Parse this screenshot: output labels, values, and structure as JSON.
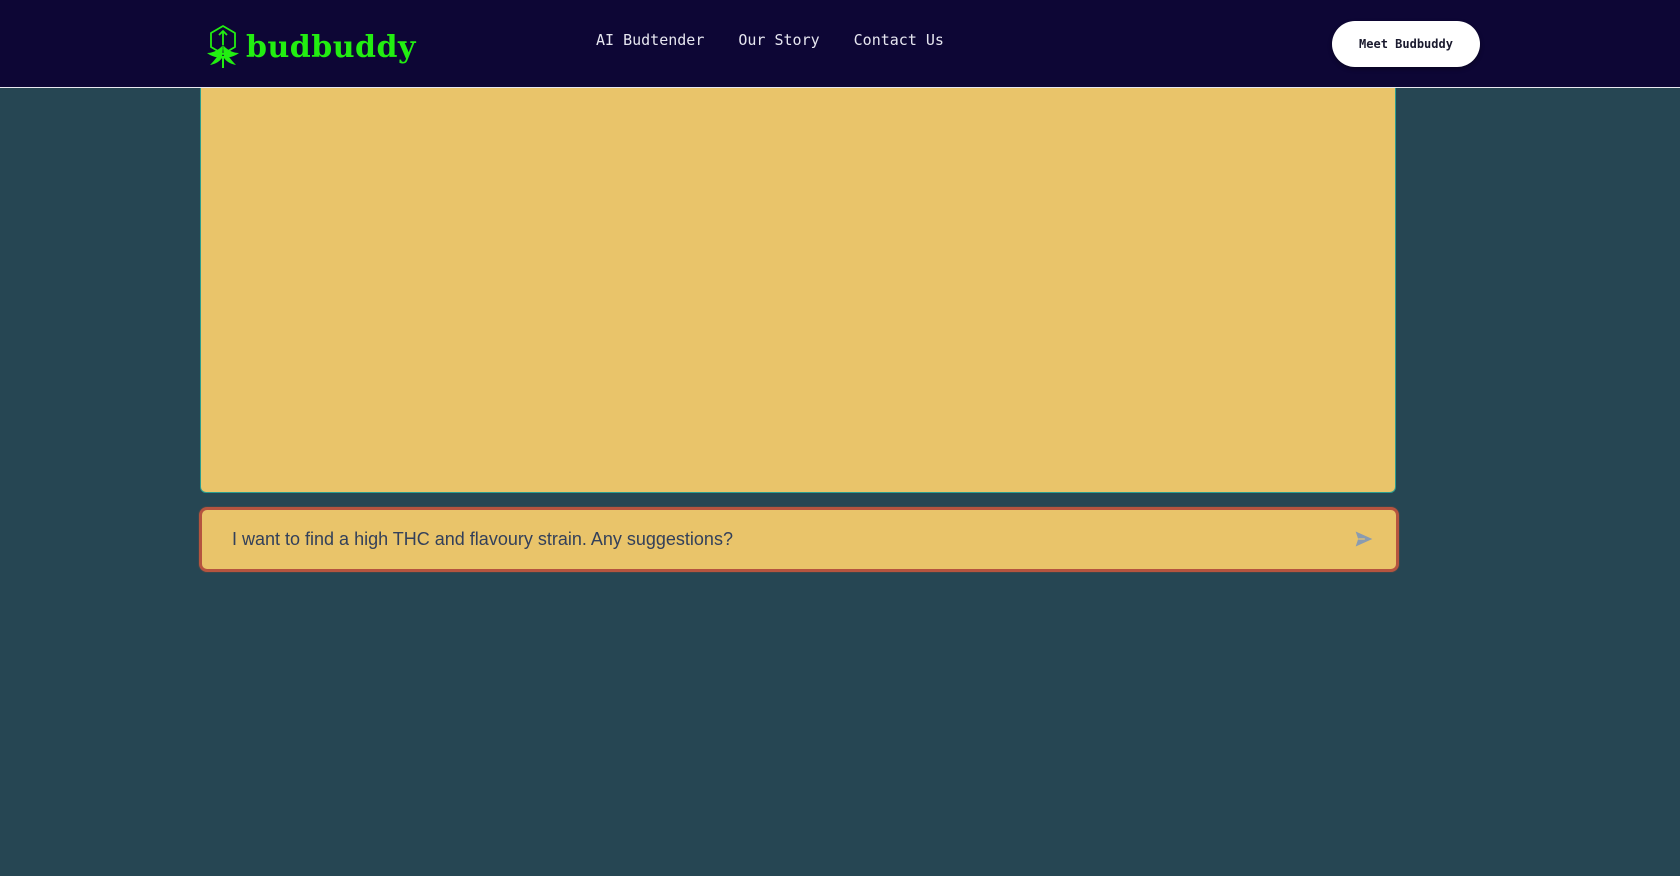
{
  "brand": {
    "name": "budbuddy",
    "color": "#22ee11"
  },
  "nav": {
    "items": [
      {
        "label": "AI Budtender"
      },
      {
        "label": "Our Story"
      },
      {
        "label": "Contact Us"
      }
    ],
    "cta_label": "Meet Budbuddy"
  },
  "chat": {
    "input_placeholder": "I want to find a high THC and flavoury strain. Any suggestions?",
    "input_value": "",
    "send_icon": "send-icon"
  },
  "colors": {
    "header_bg": "#0d0635",
    "page_bg": "#264653",
    "panel_bg": "#e9c46a",
    "input_border": "#b5543f"
  }
}
